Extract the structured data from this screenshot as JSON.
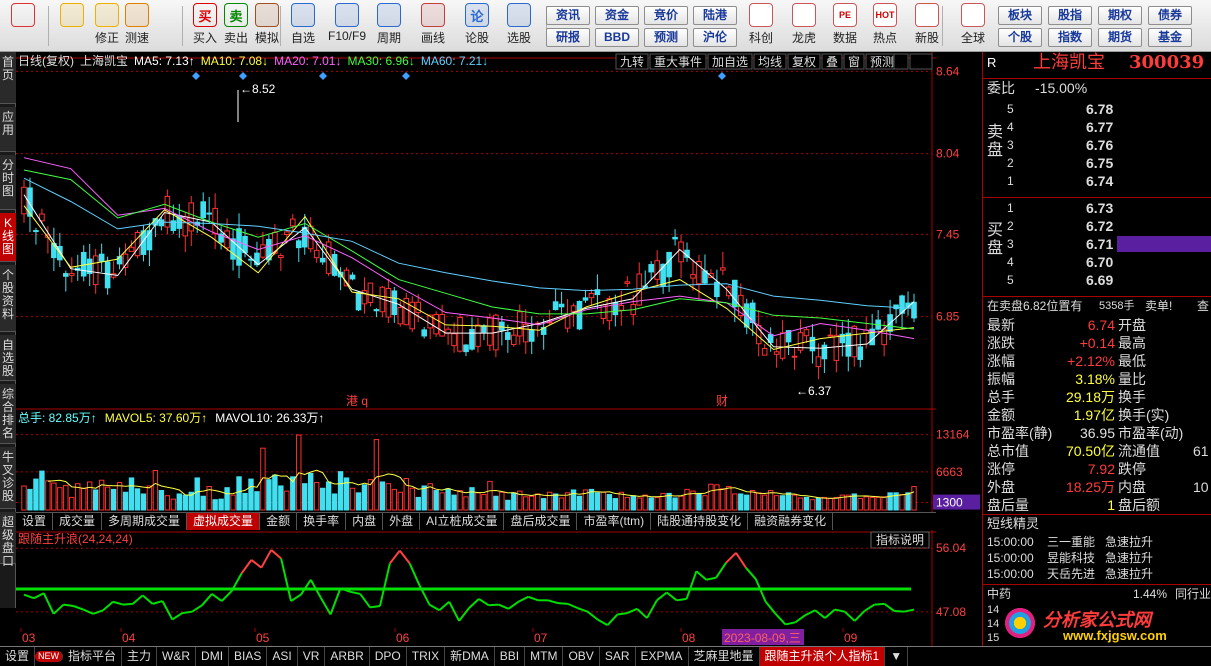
{
  "toolbar": {
    "buttons": [
      {
        "label": "",
        "icon": "layout-grid-icon",
        "color": "#d33"
      },
      {
        "label": "",
        "icon": "back-arrow-icon",
        "color": "#f0b000"
      },
      {
        "label": "修正",
        "icon": "updown-arrows-icon",
        "color": "#f0b000"
      },
      {
        "label": "测速",
        "icon": "clock-icon",
        "color": "#e08000"
      },
      {
        "label": "买入",
        "icon": "buy-icon",
        "glyph": "买",
        "color": "#d00"
      },
      {
        "label": "卖出",
        "icon": "sell-icon",
        "glyph": "卖",
        "color": "#080"
      },
      {
        "label": "模拟",
        "icon": "hammer-icon",
        "color": "#a05020"
      },
      {
        "label": "自选",
        "icon": "star-folder-icon",
        "color": "#2a6ad0"
      },
      {
        "label": "F10/F9",
        "icon": "f10-icon",
        "color": "#2a6ad0"
      },
      {
        "label": "周期",
        "icon": "period-icon",
        "color": "#2a6ad0"
      },
      {
        "label": "画线",
        "icon": "pencil-icon",
        "color": "#c04040"
      },
      {
        "label": "论股",
        "icon": "discuss-icon",
        "glyph": "论",
        "color": "#2a6ad0"
      },
      {
        "label": "选股",
        "icon": "stock-select-icon",
        "color": "#2a6ad0"
      }
    ],
    "small_buttons": [
      [
        "资讯",
        "研报"
      ],
      [
        "资金",
        "BBD"
      ],
      [
        "竞价",
        "预测"
      ],
      [
        "陆港",
        "沪伦"
      ]
    ],
    "right_buttons": [
      {
        "label": "科创",
        "icon": "kechuang-icon"
      },
      {
        "label": "龙虎",
        "icon": "dragon-tiger-icon"
      },
      {
        "label": "数据",
        "icon": "pe-data-icon",
        "glyph": "PE"
      },
      {
        "label": "热点",
        "icon": "hot-icon",
        "glyph": "HOT"
      },
      {
        "label": "新股",
        "icon": "new-stock-icon"
      },
      {
        "label": "全球",
        "icon": "globe-icon"
      }
    ],
    "right_small": [
      [
        "板块",
        "个股"
      ],
      [
        "股指",
        "指数"
      ],
      [
        "期权",
        "期货"
      ],
      [
        "债券",
        "基金"
      ]
    ]
  },
  "left_nav": [
    {
      "label": "首页"
    },
    {
      "label": "应用"
    },
    {
      "label": "分时图"
    },
    {
      "label": "K线图",
      "active": true
    },
    {
      "label": "个股资料"
    },
    {
      "label": "自选股"
    },
    {
      "label": "综合排名"
    },
    {
      "label": "牛叉诊股"
    },
    {
      "label": "超级盘口"
    }
  ],
  "chart_header": {
    "title": "日线(复权)",
    "stock": "上海凯宝",
    "ma": [
      {
        "text": "MA5: 7.13↑",
        "color": "#ffffff"
      },
      {
        "text": "MA10: 7.08↓",
        "color": "#ffff40"
      },
      {
        "text": "MA20: 7.01↓",
        "color": "#ff60ff"
      },
      {
        "text": "MA30: 6.96↓",
        "color": "#40ff40"
      },
      {
        "text": "MA60: 7.21↓",
        "color": "#60d0ff"
      }
    ],
    "right_buttons": [
      "九转",
      "重大事件",
      "加自选",
      "均线",
      "复权",
      "叠",
      "窗",
      "预测"
    ]
  },
  "chart_data": [
    {
      "type": "line",
      "title": "日线(复权)",
      "ylim": [
        6.3,
        8.65
      ],
      "y_ticks": [
        "8.64",
        "8.04",
        "7.45",
        "6.85"
      ],
      "x_ticks": [
        "03",
        "04",
        "05",
        "06",
        "07",
        "08",
        "09"
      ],
      "annotations": [
        {
          "text": "8.52"
        },
        {
          "text": "6.37"
        },
        {
          "text": "港 q"
        },
        {
          "text": "财"
        }
      ],
      "series": [
        {
          "name": "MA5",
          "values": [
            7.74,
            7.2,
            7.15,
            7.61,
            7.54,
            7.23,
            7.5,
            7.05,
            6.94,
            6.73,
            6.73,
            6.8,
            6.91,
            6.98,
            7.34,
            7.05,
            6.63,
            6.62,
            6.65,
            6.96
          ]
        },
        {
          "name": "MA10",
          "values": [
            7.66,
            7.21,
            7.27,
            7.63,
            7.43,
            7.17,
            7.58,
            7.03,
            6.98,
            6.79,
            6.78,
            6.75,
            6.92,
            7.03,
            7.12,
            6.91,
            6.61,
            6.69,
            6.73,
            6.77
          ]
        },
        {
          "name": "MA20",
          "values": [
            8.01,
            7.93,
            7.59,
            7.64,
            7.47,
            7.34,
            7.44,
            7.28,
            7.07,
            6.88,
            6.84,
            6.79,
            6.9,
            6.96,
            7,
            6.95,
            6.71,
            6.8,
            6.75,
            6.69
          ]
        },
        {
          "name": "MA30",
          "values": [
            7.92,
            7.85,
            7.57,
            7.67,
            7.54,
            7.43,
            7.53,
            7.33,
            7.12,
            7.02,
            6.92,
            6.87,
            6.87,
            6.9,
            6.98,
            6.95,
            6.86,
            6.84,
            6.8,
            6.76
          ]
        },
        {
          "name": "MA60",
          "values": [
            7.86,
            7.69,
            7.49,
            7.54,
            7.53,
            7.51,
            7.46,
            7.4,
            7.24,
            7.17,
            7.11,
            7.06,
            7.04,
            7.05,
            7.08,
            7.09,
            7,
            6.97,
            6.93,
            6.91
          ]
        }
      ]
    },
    {
      "type": "bar",
      "title": "总手",
      "ylim": [
        0,
        14500
      ],
      "y_ticks": [
        "13164",
        "6663",
        "1300"
      ],
      "legend": [
        {
          "text": "总手: 82.85万↑",
          "color": "#6ff"
        },
        {
          "text": "MAVOL5: 37.60万↑",
          "color": "#ffff40"
        },
        {
          "text": "MAVOL10: 26.33万↑",
          "color": "#fff"
        }
      ],
      "values": [
        4200,
        3600,
        5400,
        6800,
        5100,
        4700,
        3900,
        4300,
        2200,
        4600,
        3800,
        4900,
        3500,
        5200,
        4000,
        3600,
        4800,
        3100,
        5600,
        3700,
        2800,
        4200,
        6900,
        3400,
        2500,
        1900,
        2800,
        2600,
        3100,
        5600,
        2400,
        4100,
        1800,
        1900,
        3900,
        2600,
        5800,
        2900,
        5400,
        3200,
        10800,
        5300,
        6100,
        4200,
        3300,
        5800,
        13100,
        4600,
        6400,
        4800,
        3800,
        4900,
        2800,
        6700,
        5600,
        3800,
        3000,
        4400,
        5300,
        12300,
        4900,
        4600,
        3600,
        3100,
        5500,
        3800,
        2200,
        4200,
        4600,
        3400,
        3000,
        3700,
        2600,
        3400,
        2300,
        3900,
        3000,
        2700,
        5000,
        2400,
        3100,
        1700,
        3000,
        3300,
        2300,
        2400,
        2800,
        2000,
        3100,
        2800,
        2100,
        3000,
        3500,
        2400,
        3500,
        3600,
        3000,
        3100,
        2700,
        2000,
        3100,
        2200,
        2500,
        2100,
        2600,
        2100,
        2200,
        2900,
        2900,
        2100,
        2400,
        3600,
        3300,
        2900,
        2500,
        4500,
        4400,
        3700,
        4100,
        2800,
        2800,
        2600,
        3400,
        3000,
        2600,
        3400,
        2500,
        2500,
        3000,
        2600,
        2100,
        2200,
        1800,
        2100,
        2200,
        2000,
        2200,
        2600,
        2600,
        2800,
        2000,
        2300,
        2200,
        2200,
        2300,
        3000,
        3000,
        2700,
        3000,
        4100
      ]
    },
    {
      "type": "line",
      "title": "跟随主升浪(24,24,24)",
      "ylim": [
        44.8,
        57.2
      ],
      "y_ticks": [
        "56.04",
        "47.08"
      ],
      "series": [
        {
          "name": "跟随主升浪",
          "values": [
            49.5,
            49,
            49.7,
            46.8,
            48.1,
            47.9,
            47.4,
            46.8,
            47.3,
            48.5,
            48.1,
            48.2,
            49.4,
            48.2,
            48.6,
            46,
            46.9,
            47.1,
            48,
            49.6,
            48.6,
            50,
            52.5,
            54.4,
            53.3,
            55.8,
            54.6,
            48.6,
            49.5,
            51.6,
            49.1,
            46.7,
            50.4,
            49.9,
            49.6,
            47.7,
            47.9,
            53.9,
            55.7,
            53.9,
            50.8,
            48.1,
            47.3,
            48.5,
            45.8,
            47.6,
            48.9,
            48,
            48.1,
            47.5,
            48.5,
            49.2,
            48.7,
            48.7,
            48.3,
            48.2,
            47.6,
            47.1,
            46,
            45.2,
            46.7,
            46.9,
            47.5,
            46.2,
            48.7,
            49.8,
            48.7,
            48.9,
            52.8,
            51.6,
            51.9,
            54,
            55.4,
            53.3,
            51.7,
            48.5,
            46.8,
            45.3,
            45.6,
            46.6,
            47.3,
            46.2,
            47.4,
            47.1,
            45.8,
            47.2,
            48.1,
            48.2,
            47.2,
            47.1,
            47.4
          ]
        }
      ]
    }
  ],
  "subchart_labels": {
    "vol_legend": "总手: 82.85万↑",
    "ind_title": "跟随主升浪(24,24,24)",
    "ind_button": "指标说明",
    "date_tip": "2023-08-09,三"
  },
  "tabs": [
    "设置",
    "成交量",
    "多周期成交量",
    "虚拟成交量",
    "金额",
    "换手率",
    "内盘",
    "外盘",
    "AI立桩成交量",
    "盘后成交量",
    "市盈率(ttm)",
    "陆股通持股变化",
    "融资融券变化"
  ],
  "active_tab": "虚拟成交量",
  "bottom_tabs": [
    "设置",
    "NEW",
    "指标平台",
    "主力",
    "W&R",
    "DMI",
    "BIAS",
    "ASI",
    "VR",
    "ARBR",
    "DPO",
    "TRIX",
    "新DMA",
    "BBI",
    "MTM",
    "OBV",
    "SAR",
    "EXPMA",
    "芝麻里地量",
    "跟随主升浪个人指标1",
    "▼"
  ],
  "bottom_active": "跟随主升浪个人指标1",
  "side": {
    "r_label": "R",
    "name": "上海凯宝",
    "code": "300039",
    "weibi_label": "委比",
    "weibi": "-15.00%",
    "sell_label": "卖 盘",
    "buy_label": "买 盘",
    "asks": [
      {
        "lvl": "5",
        "price": "6.78"
      },
      {
        "lvl": "4",
        "price": "6.77"
      },
      {
        "lvl": "3",
        "price": "6.76"
      },
      {
        "lvl": "2",
        "price": "6.75"
      },
      {
        "lvl": "1",
        "price": "6.74"
      }
    ],
    "bids": [
      {
        "lvl": "1",
        "price": "6.73"
      },
      {
        "lvl": "2",
        "price": "6.72"
      },
      {
        "lvl": "3",
        "price": "6.71"
      },
      {
        "lvl": "4",
        "price": "6.70"
      },
      {
        "lvl": "5",
        "price": "6.69"
      }
    ],
    "big_order": "在卖盘6.82位置有",
    "big_qty": "5358手",
    "big_sell": "卖单!",
    "big_tail": "查",
    "stats": [
      {
        "l": "最新",
        "v": "6.74",
        "vc": "r",
        "r": "开盘"
      },
      {
        "l": "涨跌",
        "v": "+0.14",
        "vc": "r",
        "r": "最高"
      },
      {
        "l": "涨幅",
        "v": "+2.12%",
        "vc": "r",
        "r": "最低"
      },
      {
        "l": "振幅",
        "v": "3.18%",
        "vc": "y",
        "r": "量比"
      },
      {
        "l": "总手",
        "v": "29.18万",
        "vc": "y",
        "r": "换手"
      },
      {
        "l": "金额",
        "v": "1.97亿",
        "vc": "y",
        "r": "换手(实)"
      },
      {
        "l": "市盈率(静)",
        "v": "36.95",
        "vc": "w",
        "r": "市盈率(动)"
      },
      {
        "l": "总市值",
        "v": "70.50亿",
        "vc": "y",
        "r": "流通值",
        "rv": "61"
      },
      {
        "l": "涨停",
        "v": "7.92",
        "vc": "r",
        "r": "跌停"
      },
      {
        "l": "外盘",
        "v": "18.25万",
        "vc": "r",
        "r": "内盘",
        "rv": "10"
      },
      {
        "l": "盘后量",
        "v": "1",
        "vc": "y",
        "r": "盘后额"
      }
    ],
    "dx_title": "短线精灵",
    "alerts": [
      {
        "time": "15:00:00",
        "name": "三一重能",
        "action": "急速拉升"
      },
      {
        "time": "15:00:00",
        "name": "昱能科技",
        "action": "急速拉升"
      },
      {
        "time": "15:00:00",
        "name": "天岳先进",
        "action": "急速拉升"
      }
    ],
    "sector": "中药",
    "sector_pct": "1.44%",
    "sector_right": "同行业",
    "small_nums": [
      "14",
      "14",
      "15"
    ],
    "logo_text": "分析家公式网",
    "logo_url": "www.fxjgsw.com"
  }
}
